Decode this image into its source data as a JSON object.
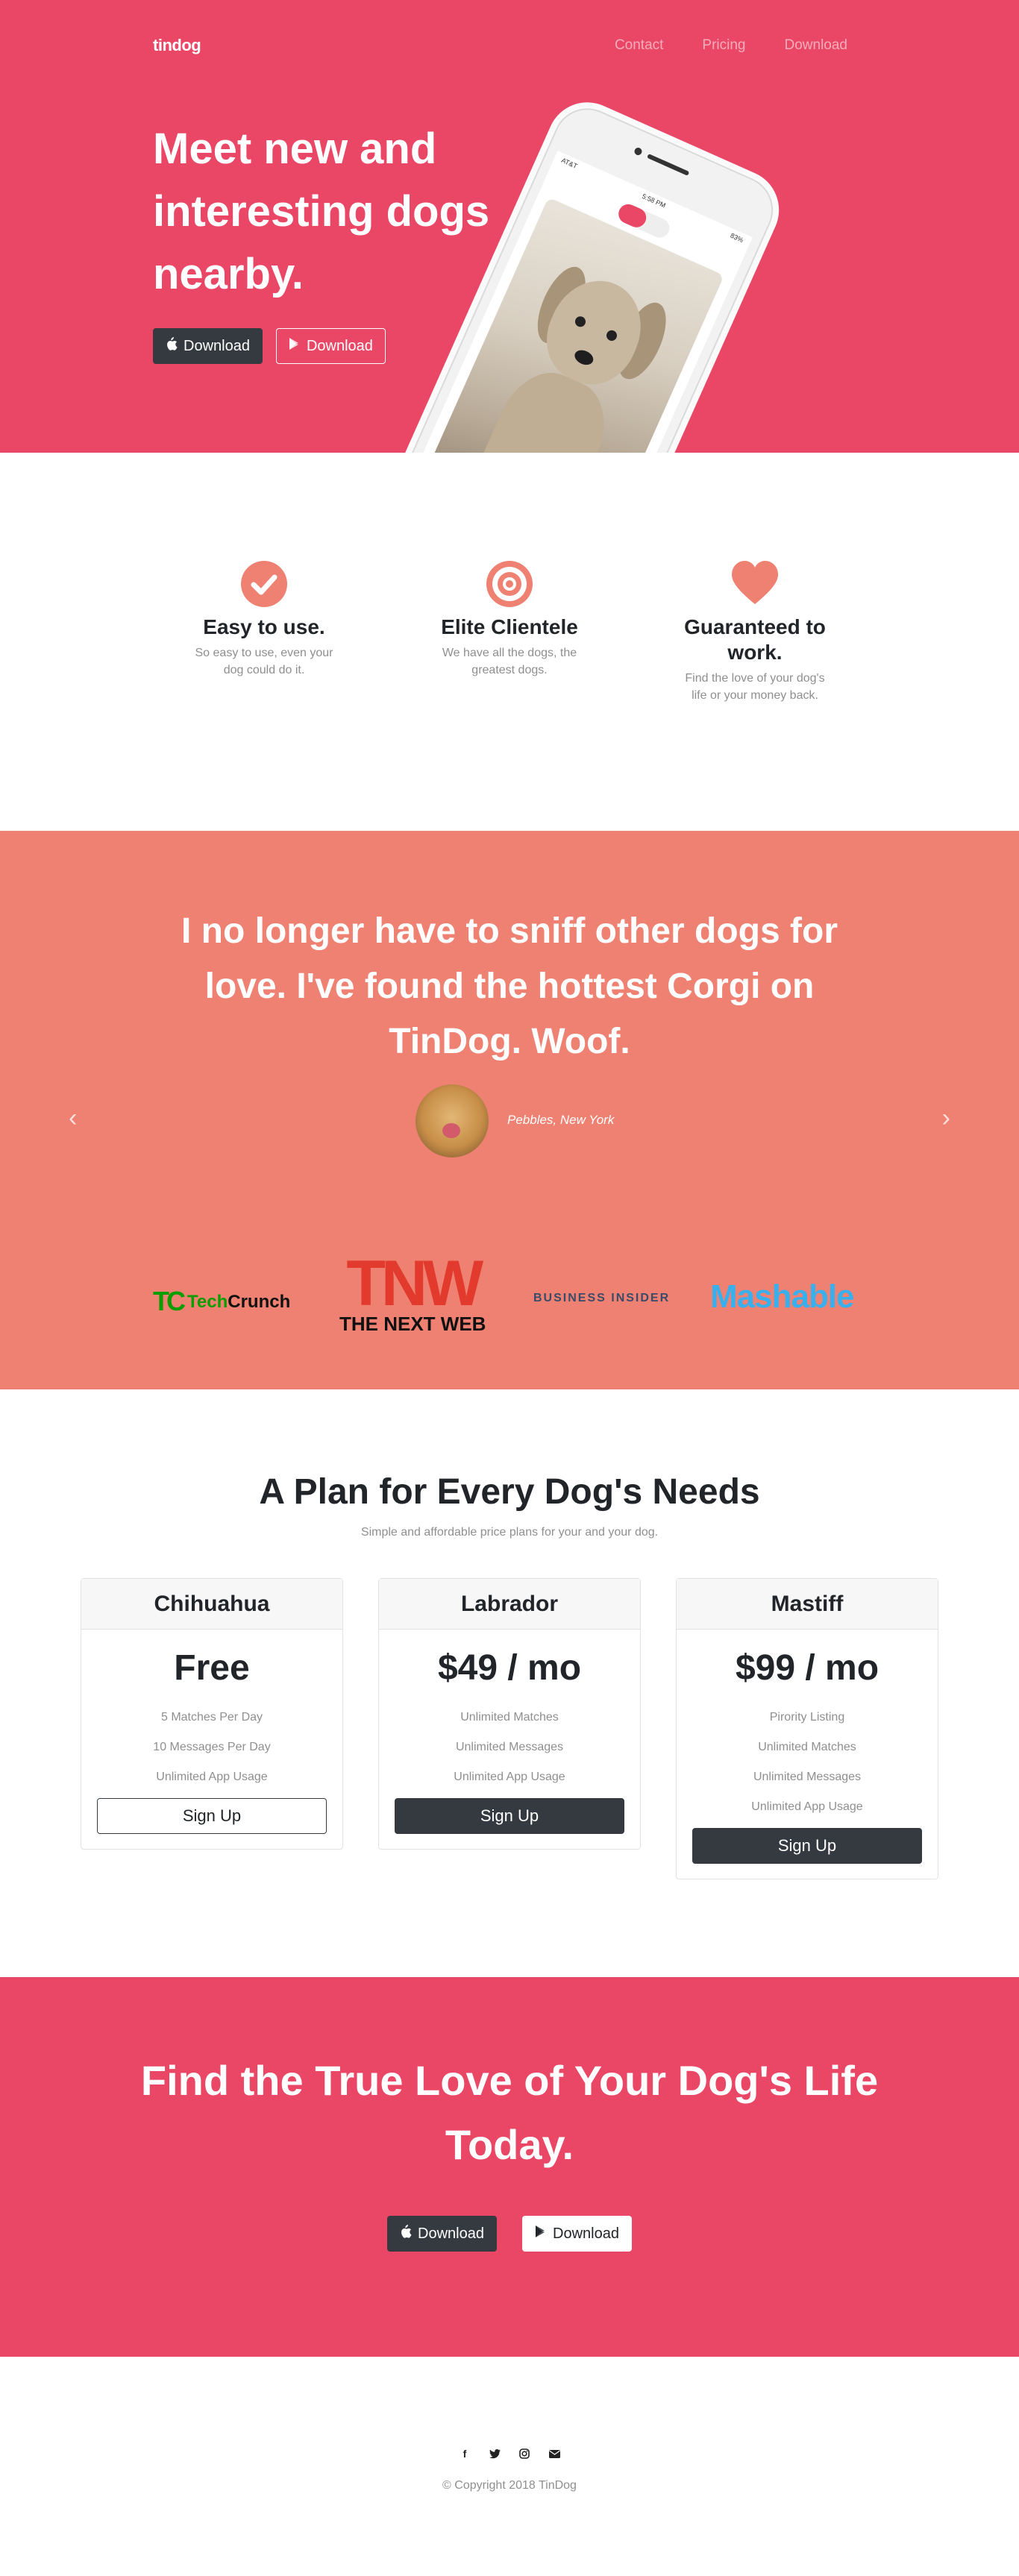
{
  "colors": {
    "primary": "#ea4766",
    "secondary": "#ef8172",
    "dark": "#343a40",
    "muted": "#8f8f8f"
  },
  "hero": {
    "brand": "tindog",
    "nav": [
      {
        "label": "Contact"
      },
      {
        "label": "Pricing"
      },
      {
        "label": "Download"
      }
    ],
    "title": "Meet new and interesting dogs nearby.",
    "buttons": [
      {
        "icon": "apple-icon",
        "label": "Download"
      },
      {
        "icon": "google-play-icon",
        "label": "Download"
      }
    ],
    "phone": {
      "carrier": "AT&T",
      "time": "5:58 PM",
      "battery": "83%"
    }
  },
  "features": [
    {
      "icon": "check-circle-icon",
      "title": "Easy to use.",
      "text": "So easy to use, even your dog could do it."
    },
    {
      "icon": "bullseye-icon",
      "title": "Elite Clientele",
      "text": "We have all the dogs, the greatest dogs."
    },
    {
      "icon": "heart-icon",
      "title": "Guaranteed to work.",
      "text": "Find the love of your dog's life or your money back."
    }
  ],
  "testimonial": {
    "quote": "I no longer have to sniff other dogs for love. I've found the hottest Corgi on TinDog. Woof.",
    "author": "Pebbles, New York"
  },
  "press": {
    "techcrunch": {
      "mark": "TC",
      "name_a": "Tech",
      "name_b": "Crunch"
    },
    "tnw": {
      "mark": "TNW",
      "name": "THE NEXT WEB"
    },
    "business_insider": "BUSINESS INSIDER",
    "mashable": "Mashable"
  },
  "pricing": {
    "title": "A Plan for Every Dog's Needs",
    "subtitle": "Simple and affordable price plans for your and your dog.",
    "plans": [
      {
        "name": "Chihuahua",
        "price": "Free",
        "features": [
          "5 Matches Per Day",
          "10 Messages Per Day",
          "Unlimited App Usage"
        ],
        "cta": "Sign Up"
      },
      {
        "name": "Labrador",
        "price": "$49 / mo",
        "features": [
          "Unlimited Matches",
          "Unlimited Messages",
          "Unlimited App Usage"
        ],
        "cta": "Sign Up"
      },
      {
        "name": "Mastiff",
        "price": "$99 / mo",
        "features": [
          "Pirority Listing",
          "Unlimited Matches",
          "Unlimited Messages",
          "Unlimited App Usage"
        ],
        "cta": "Sign Up"
      }
    ]
  },
  "cta": {
    "title": "Find the True Love of Your Dog's Life Today.",
    "buttons": [
      {
        "icon": "apple-icon",
        "label": "Download"
      },
      {
        "icon": "google-play-icon",
        "label": "Download"
      }
    ]
  },
  "footer": {
    "social": [
      "facebook-icon",
      "twitter-icon",
      "instagram-icon",
      "envelope-icon"
    ],
    "copyright": "© Copyright 2018 TinDog"
  }
}
